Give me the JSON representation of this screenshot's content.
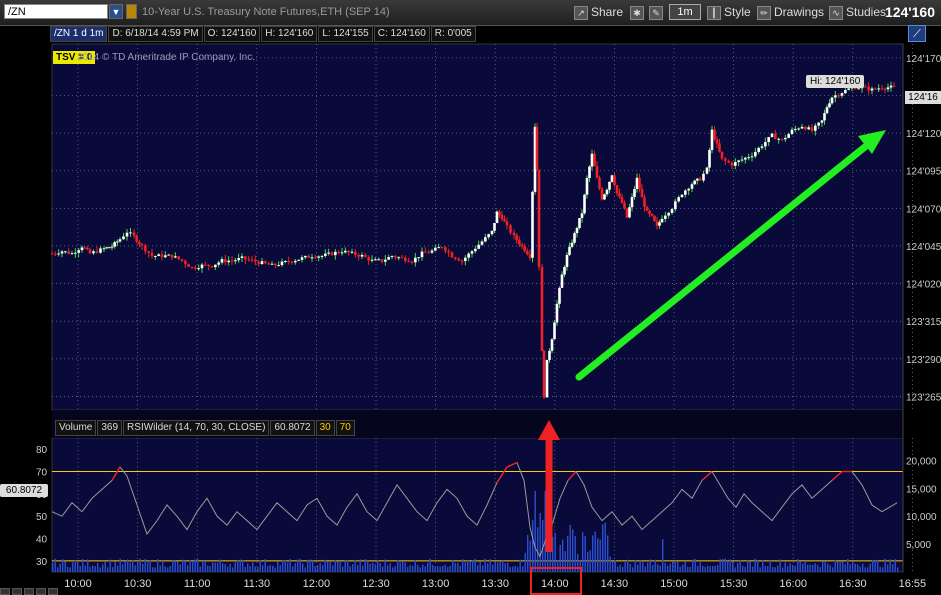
{
  "toolbar": {
    "symbol": "/ZN",
    "description": "10-Year U.S. Treasury Note Futures,ETH (SEP 14)",
    "share_label": "Share",
    "timeframe": "1m",
    "style_label": "Style",
    "drawings_label": "Drawings",
    "studies_label": "Studies",
    "last_price": "124'160"
  },
  "info": {
    "symbol_period": "/ZN 1 d 1m",
    "date": "D: 6/18/14 4:59 PM",
    "open": "O: 124'160",
    "high": "H: 124'160",
    "low": "L: 124'155",
    "close": "C: 124'160",
    "range": "R: 0'005"
  },
  "overlay": {
    "tsv": "TSV = 0",
    "copyright": "2014 © TD Ameritrade IP Company, Inc.",
    "hi_tag": "Hi: 124'160",
    "current_price_tag": "124'16"
  },
  "lower": {
    "volume_label": "Volume",
    "volume_value": "369",
    "rsi_label": "RSIWilder (14, 70, 30, CLOSE)",
    "rsi_value": "60.8072",
    "rsi_low": "30",
    "rsi_high": "70",
    "rsi_tag": "60.8072"
  },
  "colors": {
    "plot_bg": "#0a0a3a",
    "up": "#44dd44",
    "down": "#ee2222",
    "rsi": "#9a9a9a",
    "volume": "#2a4fd0",
    "overbought": "#ffcc00",
    "arrow_green": "#22ee22",
    "arrow_red": "#ee2222"
  },
  "chart_data": {
    "type": "line",
    "x_ticks": [
      "10:00",
      "10:30",
      "11:00",
      "11:30",
      "12:00",
      "12:30",
      "13:00",
      "13:30",
      "14:00",
      "14:30",
      "15:00",
      "15:30",
      "16:00",
      "16:30",
      "16:55"
    ],
    "price_axis": [
      "124'170",
      "124'145",
      "124'120",
      "124'095",
      "124'070",
      "124'045",
      "124'020",
      "123'315",
      "123'290",
      "123'265"
    ],
    "price_axis_values": [
      124.53125,
      124.453125,
      124.375,
      124.296875,
      124.21875,
      124.140625,
      124.0625,
      123.984375,
      123.90625,
      123.828125
    ],
    "rsi_axis": [
      "80",
      "70",
      "60",
      "50",
      "40",
      "30"
    ],
    "volume_axis": [
      "20,000",
      "15,000",
      "10,000",
      "5,000"
    ],
    "price_path": [
      [
        0,
        124.125
      ],
      [
        10,
        124.13
      ],
      [
        20,
        124.125
      ],
      [
        30,
        124.14
      ],
      [
        38,
        124.125
      ],
      [
        45,
        124.13
      ],
      [
        52,
        124.135
      ],
      [
        60,
        124.14
      ],
      [
        68,
        124.155
      ],
      [
        75,
        124.17
      ],
      [
        82,
        124.16
      ],
      [
        90,
        124.14
      ],
      [
        100,
        124.12
      ],
      [
        110,
        124.12
      ],
      [
        120,
        124.12
      ],
      [
        130,
        124.11
      ],
      [
        140,
        124.095
      ],
      [
        150,
        124.1
      ],
      [
        160,
        124.1
      ],
      [
        170,
        124.11
      ],
      [
        180,
        124.11
      ],
      [
        190,
        124.115
      ],
      [
        200,
        124.11
      ],
      [
        210,
        124.105
      ],
      [
        220,
        124.1
      ],
      [
        230,
        124.105
      ],
      [
        240,
        124.11
      ],
      [
        250,
        124.115
      ],
      [
        260,
        124.12
      ],
      [
        270,
        124.12
      ],
      [
        280,
        124.125
      ],
      [
        290,
        124.13
      ],
      [
        300,
        124.125
      ],
      [
        310,
        124.12
      ],
      [
        320,
        124.11
      ],
      [
        330,
        124.11
      ],
      [
        340,
        124.12
      ],
      [
        350,
        124.115
      ],
      [
        360,
        124.11
      ],
      [
        370,
        124.125
      ],
      [
        380,
        124.13
      ],
      [
        390,
        124.14
      ],
      [
        400,
        124.12
      ],
      [
        410,
        124.11
      ],
      [
        420,
        124.13
      ],
      [
        430,
        124.15
      ],
      [
        440,
        124.17
      ],
      [
        445,
        124.21
      ],
      [
        450,
        124.2
      ],
      [
        455,
        124.18
      ],
      [
        462,
        124.16
      ],
      [
        470,
        124.14
      ],
      [
        478,
        124.12
      ],
      [
        483,
        124.39
      ],
      [
        485,
        124.3
      ],
      [
        487,
        124.1
      ],
      [
        490,
        123.92
      ],
      [
        492,
        123.83
      ],
      [
        495,
        123.9
      ],
      [
        500,
        123.95
      ],
      [
        505,
        124.02
      ],
      [
        510,
        124.08
      ],
      [
        515,
        124.12
      ],
      [
        520,
        124.15
      ],
      [
        525,
        124.18
      ],
      [
        530,
        124.21
      ],
      [
        535,
        124.28
      ],
      [
        540,
        124.33
      ],
      [
        545,
        124.28
      ],
      [
        550,
        124.24
      ],
      [
        555,
        124.26
      ],
      [
        560,
        124.29
      ],
      [
        565,
        124.25
      ],
      [
        570,
        124.23
      ],
      [
        575,
        124.2
      ],
      [
        580,
        124.24
      ],
      [
        585,
        124.28
      ],
      [
        590,
        124.24
      ],
      [
        595,
        124.21
      ],
      [
        600,
        124.2
      ],
      [
        605,
        124.18
      ],
      [
        610,
        124.2
      ],
      [
        620,
        124.22
      ],
      [
        630,
        124.25
      ],
      [
        640,
        124.27
      ],
      [
        648,
        124.28
      ],
      [
        655,
        124.3
      ],
      [
        660,
        124.38
      ],
      [
        665,
        124.35
      ],
      [
        670,
        124.32
      ],
      [
        680,
        124.31
      ],
      [
        690,
        124.32
      ],
      [
        700,
        124.33
      ],
      [
        710,
        124.35
      ],
      [
        720,
        124.37
      ],
      [
        730,
        124.36
      ],
      [
        740,
        124.38
      ],
      [
        750,
        124.39
      ],
      [
        760,
        124.38
      ],
      [
        770,
        124.4
      ],
      [
        775,
        124.43
      ],
      [
        780,
        124.45
      ],
      [
        790,
        124.46
      ],
      [
        800,
        124.47
      ],
      [
        810,
        124.47
      ],
      [
        820,
        124.465
      ],
      [
        830,
        124.47
      ],
      [
        845,
        124.47
      ]
    ],
    "rsi_path": [
      [
        0,
        52
      ],
      [
        10,
        50
      ],
      [
        20,
        56
      ],
      [
        30,
        52
      ],
      [
        40,
        58
      ],
      [
        50,
        62
      ],
      [
        60,
        66
      ],
      [
        68,
        72
      ],
      [
        75,
        68
      ],
      [
        85,
        55
      ],
      [
        95,
        42
      ],
      [
        105,
        48
      ],
      [
        115,
        55
      ],
      [
        125,
        50
      ],
      [
        135,
        44
      ],
      [
        145,
        52
      ],
      [
        155,
        58
      ],
      [
        165,
        50
      ],
      [
        175,
        46
      ],
      [
        185,
        52
      ],
      [
        195,
        48
      ],
      [
        205,
        44
      ],
      [
        215,
        50
      ],
      [
        225,
        56
      ],
      [
        235,
        52
      ],
      [
        245,
        48
      ],
      [
        255,
        55
      ],
      [
        265,
        58
      ],
      [
        275,
        50
      ],
      [
        285,
        46
      ],
      [
        295,
        54
      ],
      [
        305,
        60
      ],
      [
        315,
        52
      ],
      [
        325,
        48
      ],
      [
        335,
        56
      ],
      [
        345,
        64
      ],
      [
        355,
        58
      ],
      [
        365,
        52
      ],
      [
        375,
        48
      ],
      [
        385,
        56
      ],
      [
        395,
        62
      ],
      [
        405,
        58
      ],
      [
        415,
        50
      ],
      [
        425,
        46
      ],
      [
        435,
        55
      ],
      [
        445,
        65
      ],
      [
        455,
        72
      ],
      [
        465,
        74
      ],
      [
        472,
        66
      ],
      [
        478,
        45
      ],
      [
        483,
        36
      ],
      [
        488,
        32
      ],
      [
        494,
        40
      ],
      [
        500,
        46
      ],
      [
        508,
        58
      ],
      [
        516,
        66
      ],
      [
        524,
        70
      ],
      [
        532,
        64
      ],
      [
        540,
        54
      ],
      [
        550,
        48
      ],
      [
        560,
        52
      ],
      [
        570,
        46
      ],
      [
        580,
        50
      ],
      [
        590,
        44
      ],
      [
        600,
        48
      ],
      [
        610,
        52
      ],
      [
        620,
        56
      ],
      [
        630,
        62
      ],
      [
        640,
        58
      ],
      [
        650,
        66
      ],
      [
        660,
        70
      ],
      [
        668,
        64
      ],
      [
        676,
        58
      ],
      [
        684,
        54
      ],
      [
        692,
        60
      ],
      [
        700,
        56
      ],
      [
        710,
        52
      ],
      [
        720,
        48
      ],
      [
        730,
        54
      ],
      [
        740,
        60
      ],
      [
        750,
        64
      ],
      [
        760,
        58
      ],
      [
        770,
        62
      ],
      [
        780,
        66
      ],
      [
        790,
        70
      ],
      [
        800,
        70
      ],
      [
        810,
        64
      ],
      [
        820,
        55
      ],
      [
        830,
        52
      ],
      [
        845,
        56
      ]
    ],
    "rsi_ylim": [
      25,
      85
    ],
    "price_ylim": [
      123.8,
      124.56
    ],
    "volume_ylim": [
      0,
      24000
    ],
    "volume_spike_region": [
      470,
      560
    ]
  }
}
